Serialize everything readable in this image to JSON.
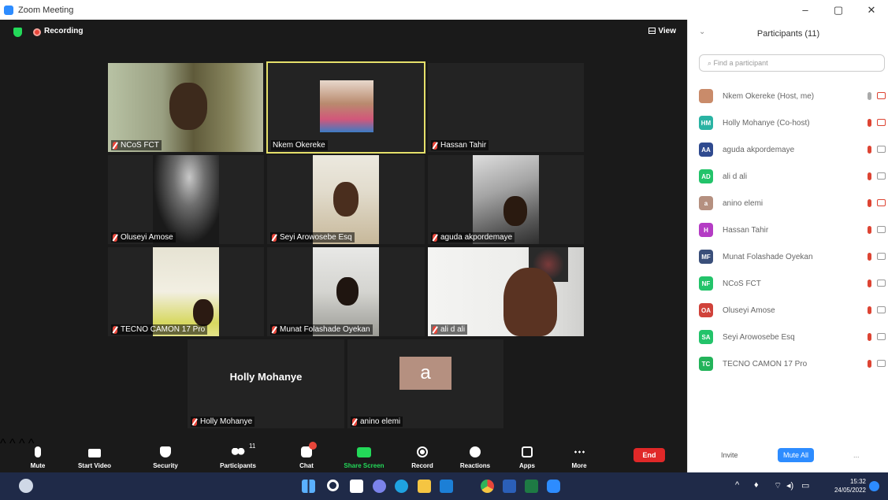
{
  "window": {
    "title": "Zoom Meeting",
    "controls": {
      "minimize": "–",
      "restore": "▢",
      "close": "✕"
    }
  },
  "topbar": {
    "recording_label": "Recording",
    "view_label": "View"
  },
  "tiles": [
    {
      "name": "NCoS FCT",
      "muted": true
    },
    {
      "name": "Nkem Okereke",
      "muted": false,
      "active": true
    },
    {
      "name": "Hassan Tahir",
      "muted": true
    },
    {
      "name": "Oluseyi Amose",
      "muted": true
    },
    {
      "name": "Seyi Arowosebe Esq",
      "muted": true
    },
    {
      "name": "aguda akpordemaye",
      "muted": true
    },
    {
      "name": "TECNO CAMON 17 Pro",
      "muted": true
    },
    {
      "name": "Munat Folashade Oyekan",
      "muted": true
    },
    {
      "name": "ali d ali",
      "muted": true
    },
    {
      "name": "Holly Mohanye",
      "muted": true,
      "display_name": "Holly Mohanye"
    },
    {
      "name": "anino elemi",
      "muted": true,
      "letter": "a"
    }
  ],
  "toolbar": {
    "mute": "Mute",
    "start_video": "Start Video",
    "security": "Security",
    "participants": "Participants",
    "participants_count": "11",
    "chat": "Chat",
    "share_screen": "Share Screen",
    "record": "Record",
    "reactions": "Reactions",
    "apps": "Apps",
    "more": "More",
    "end": "End"
  },
  "panel": {
    "title": "Participants (11)",
    "search_placeholder": "Find a participant",
    "participants": [
      {
        "initials": "",
        "name": "Nkem Okereke (Host, me)",
        "color": "#c98b6a"
      },
      {
        "initials": "HM",
        "name": "Holly Mohanye (Co-host)",
        "color": "#2ab3a3"
      },
      {
        "initials": "AA",
        "name": "aguda akpordemaye",
        "color": "#2f4a8f"
      },
      {
        "initials": "AD",
        "name": "ali d ali",
        "color": "#23c36a"
      },
      {
        "initials": "a",
        "name": "anino elemi",
        "color": "#b59080"
      },
      {
        "initials": "H",
        "name": "Hassan Tahir",
        "color": "#b43cc4"
      },
      {
        "initials": "MF",
        "name": "Munat Folashade Oyekan",
        "color": "#3a4f7a"
      },
      {
        "initials": "NF",
        "name": "NCoS FCT",
        "color": "#23c36a"
      },
      {
        "initials": "OA",
        "name": "Oluseyi Amose",
        "color": "#d0423a"
      },
      {
        "initials": "SA",
        "name": "Seyi Arowosebe Esq",
        "color": "#23c36a"
      },
      {
        "initials": "TC",
        "name": "TECNO CAMON 17 Pro",
        "color": "#23b35a"
      }
    ],
    "invite_label": "Invite",
    "mute_all_label": "Mute All",
    "more_label": "..."
  },
  "taskbar": {
    "time": "15:32",
    "date": "24/05/2022"
  }
}
